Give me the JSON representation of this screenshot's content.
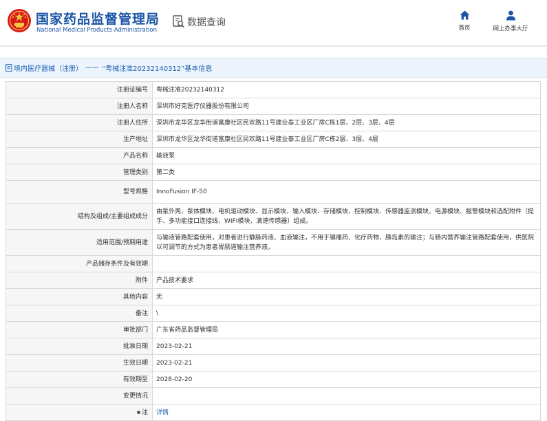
{
  "header": {
    "title_cn": "国家药品监督管理局",
    "title_en": "National Medical Products Administration",
    "query_label": "数据查询",
    "nav": [
      {
        "label": "首页",
        "icon": "home-icon"
      },
      {
        "label": "网上办事大厅",
        "icon": "user-icon"
      }
    ]
  },
  "breadcrumb": {
    "category": "境内医疗器械（注册）",
    "separator": "——",
    "record": "“粤械注准20232140312”基本信息"
  },
  "record": {
    "fields": [
      {
        "label": "注册证编号",
        "value": "粤械注准20232140312"
      },
      {
        "label": "注册人名称",
        "value": "深圳市好克医疗仪器股份有限公司"
      },
      {
        "label": "注册人住所",
        "value": "深圳市龙华区龙华街道富康社区民欢路11号建业泰工业区厂房C栋1层、2层、3层、4层"
      },
      {
        "label": "生产地址",
        "value": "深圳市龙华区龙华街道富康社区民欢路11号建业泰工业区厂房C栋2层、3层、4层"
      },
      {
        "label": "产品名称",
        "value": "输液泵"
      },
      {
        "label": "管理类别",
        "value": "第二类"
      },
      {
        "label": "型号规格",
        "value": "InnoFusion IF-50"
      },
      {
        "label": "结构及组成/主要组成成分",
        "value": "由泵外壳、泵体模块、电机驱动模块、显示模块、输入模块、存储模块、控制模块、传感器监测模块、电源模块、报警模块和选配附件（提手、多功能接口连接线、WIFI模块、滴速传感器）组成。"
      },
      {
        "label": "适用范围/预期用途",
        "value": "与输液管路配套使用，对患者进行静脉药液、血液输注，不用于镇痛药、化疗药物、胰岛素的输注；与肠内营养输注管路配套使用，供医院以可调节的方式为患者胃肠道输注营养液。"
      },
      {
        "label": "产品储存条件及有效期",
        "value": ""
      },
      {
        "label": "附件",
        "value": "产品技术要求"
      },
      {
        "label": "其他内容",
        "value": "无"
      },
      {
        "label": "备注",
        "value": "\\"
      },
      {
        "label": "审批部门",
        "value": "广东省药品监督管理局"
      },
      {
        "label": "批准日期",
        "value": "2023-02-21"
      },
      {
        "label": "生效日期",
        "value": "2023-02-21"
      },
      {
        "label": "有效期至",
        "value": "2028-02-20"
      },
      {
        "label": "变更情况",
        "value": ""
      }
    ],
    "note": {
      "label": "注",
      "value": "详情"
    }
  },
  "colors": {
    "brand_blue": "#1a55a6",
    "link_blue": "#1a5fb4",
    "emblem_red": "#d7191a",
    "emblem_gold": "#f3c443",
    "label_bg": "#f6f6f6",
    "crumb_bg": "#eef4fb"
  }
}
